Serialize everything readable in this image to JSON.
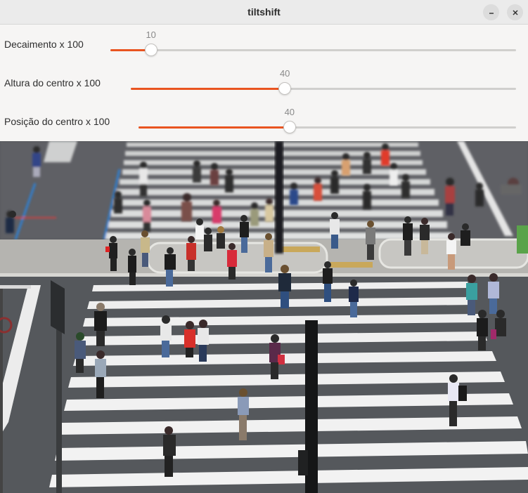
{
  "window": {
    "title": "tiltshift",
    "minimize_icon": "minimize-icon",
    "close_icon": "close-icon"
  },
  "sliders": [
    {
      "label": "Decaimento x 100",
      "value": "10",
      "fraction": 0.1
    },
    {
      "label": "Altura do centro x 100",
      "value": "40",
      "fraction": 0.4
    },
    {
      "label": "Posição do centro x 100",
      "value": "40",
      "fraction": 0.4
    }
  ],
  "colors": {
    "accent": "#e95420",
    "track": "#d0cfcd",
    "asphalt": "#55585c",
    "stripe": "#f2f2f2"
  },
  "image": {
    "description_icon": "crosswalk-photo"
  }
}
